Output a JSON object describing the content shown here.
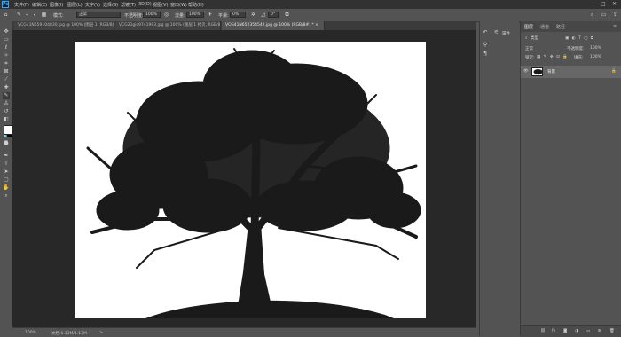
{
  "app": {
    "logo": "Ps"
  },
  "menu": [
    "文件(F)",
    "编辑(E)",
    "图像(I)",
    "图层(L)",
    "文字(Y)",
    "选择(S)",
    "滤镜(T)",
    "3D(D)",
    "视图(V)",
    "窗口(W)",
    "帮助(H)"
  ],
  "window_controls": [
    "—",
    "□",
    "✕"
  ],
  "options": {
    "mode_label": "模式:",
    "mode_value": "正常",
    "opacity_label": "不透明度:",
    "opacity_value": "100%",
    "flow_label": "流量:",
    "flow_value": "100%",
    "smooth_label": "平滑:",
    "smooth_value": "0%",
    "angle_value": "0°"
  },
  "tabs": [
    "VCG41N659104830.jpg @ 100% (图层 1, RGB/8) ×",
    "VCG21gic9741993.jpg @ 100% (图层 1 拷贝, RGB/8) ×",
    "VCG41N652354542.jpg @ 100% (RGB/8#) * ×"
  ],
  "active_tab": 2,
  "status": {
    "zoom": "100%",
    "doc": "文档:1.13M/1.13M",
    "arrow": ">"
  },
  "properties": {
    "title": "属性"
  },
  "panel": {
    "tabs": [
      "图层",
      "通道",
      "路径"
    ],
    "kind": "类型",
    "blend": "正常",
    "opacity_label": "不透明度:",
    "opacity_value": "100%",
    "lock_label": "锁定:",
    "fill_label": "填充:",
    "fill_value": "100%",
    "layer_name": "背景"
  },
  "icons": {
    "tools": [
      "move-icon",
      "marquee-icon",
      "lasso-icon",
      "magic-wand-icon",
      "crop-icon",
      "frame-icon",
      "eyedropper-icon",
      "healing-icon",
      "brush-icon",
      "stamp-icon",
      "history-brush-icon",
      "eraser-icon",
      "gradient-icon",
      "blur-icon",
      "dodge-icon",
      "pen-icon",
      "type-icon",
      "path-select-icon",
      "rectangle-icon",
      "hand-icon",
      "zoom-icon"
    ]
  },
  "colors": {
    "foreground": "#ffffff",
    "background": "#000000",
    "accent": "#31a8ff"
  }
}
